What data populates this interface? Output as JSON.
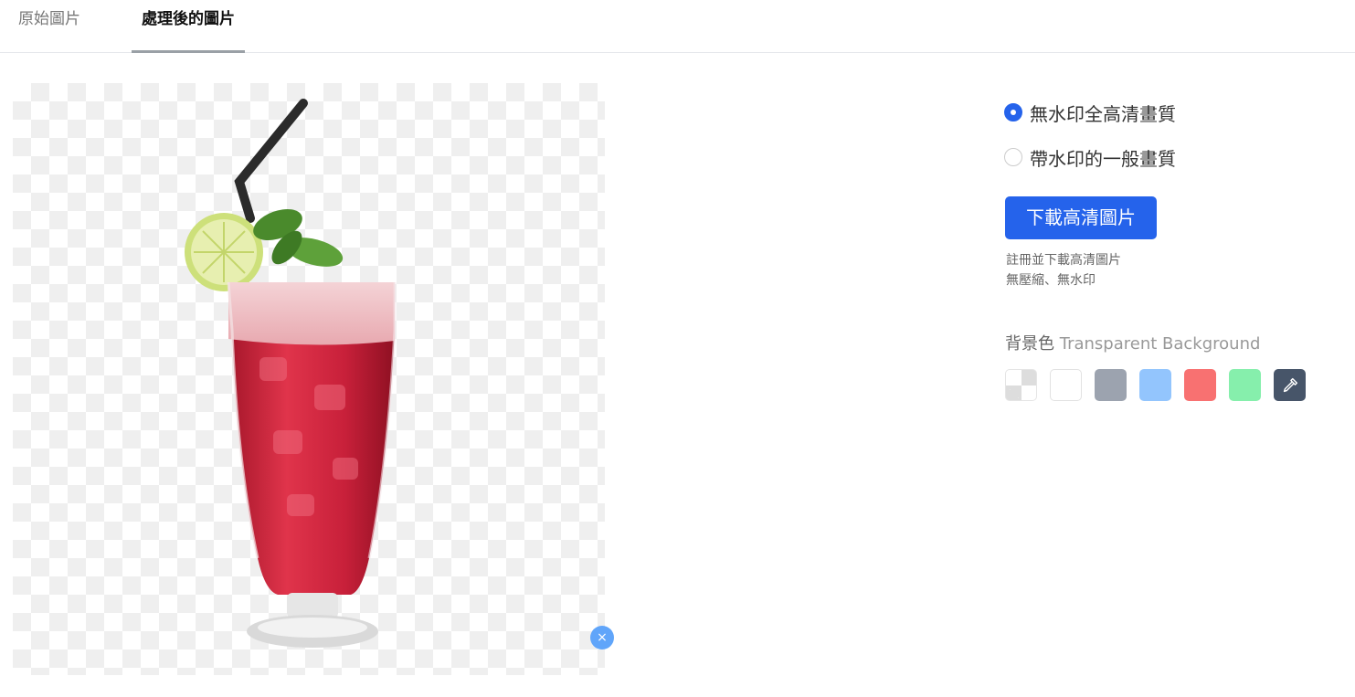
{
  "tabs": [
    {
      "label": "原始圖片",
      "active": false
    },
    {
      "label": "處理後的圖片",
      "active": true
    }
  ],
  "close_button": {
    "symbol": "×",
    "icon": "close-icon"
  },
  "quality_options": [
    {
      "label": "無水印全高清畫質",
      "selected": true
    },
    {
      "label": "帶水印的一般畫質",
      "selected": false
    }
  ],
  "download_button": {
    "label": "下載高清圖片"
  },
  "notes": [
    "註冊並下載高清圖片",
    "無壓縮、無水印"
  ],
  "background": {
    "label": "背景色",
    "sublabel": "Transparent Background",
    "swatches": [
      {
        "name": "transparent",
        "color": "checker"
      },
      {
        "name": "white",
        "color": "#ffffff"
      },
      {
        "name": "gray",
        "color": "#9ca3af"
      },
      {
        "name": "blue",
        "color": "#93c5fd"
      },
      {
        "name": "red",
        "color": "#f87171"
      },
      {
        "name": "green",
        "color": "#86efac"
      },
      {
        "name": "picker",
        "color": "#475569",
        "icon": "eyedropper-icon"
      }
    ]
  },
  "colors": {
    "accent": "#2563eb",
    "close": "#60a5fa"
  }
}
